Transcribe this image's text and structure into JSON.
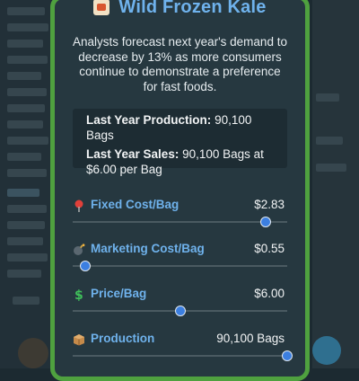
{
  "dialog": {
    "title": "Wild Frozen Kale",
    "title_icon": "kale-box-icon",
    "description": "Analysts forecast next year's demand to decrease by 13% as more consumers continue to demonstrate a preference for fast foods."
  },
  "stats": {
    "production_label": "Last Year Production:",
    "production_value": "90,100 Bags",
    "sales_label": "Last Year Sales:",
    "sales_value": "90,100 Bags at $6.00 per Bag"
  },
  "sliders": [
    {
      "label": "Fixed Cost/Bag",
      "value": "$2.83",
      "icon": "pushpin-icon",
      "level": 0.9
    },
    {
      "label": "Marketing Cost/Bag",
      "value": "$0.55",
      "icon": "bomb-icon",
      "level": 0.06
    },
    {
      "label": "Price/Bag",
      "value": "$6.00",
      "icon": "dollar-icon",
      "level": 0.5
    },
    {
      "label": "Production",
      "value": "90,100 Bags",
      "icon": "package-icon",
      "level": 1.0
    }
  ],
  "colors": {
    "accent_green": "#4fa13f",
    "label_blue": "#6fb2ec",
    "thumb_blue": "#3c7fe0",
    "panel": "#263840"
  }
}
